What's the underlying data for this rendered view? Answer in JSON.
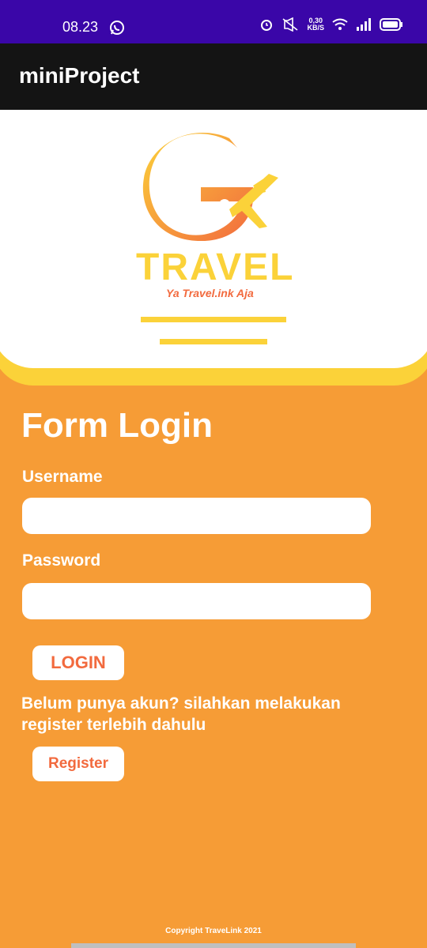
{
  "status_bar": {
    "time": "08.23",
    "net_speed_value": "0,30",
    "net_speed_unit": "KB/S",
    "icons": [
      "whatsapp-icon",
      "alarm-icon",
      "mute-icon",
      "wifi-icon",
      "signal-icon",
      "battery-icon"
    ]
  },
  "app_bar": {
    "title": "miniProject"
  },
  "brand": {
    "name": "TRAVEL",
    "tagline": "Ya Travel.ink Aja",
    "colors": {
      "yellow": "#FBD239",
      "orange": "#F26A3E"
    }
  },
  "form": {
    "title": "Form Login",
    "username_label": "Username",
    "username_value": "",
    "password_label": "Password",
    "password_value": "",
    "login_button": "LOGIN",
    "register_hint": "Belum punya akun? silahkan melakukan register terlebih dahulu",
    "register_button": "Register"
  },
  "footer": {
    "copyright": "Copyright TraveLink 2021"
  },
  "colors": {
    "background": "#F69C36",
    "status_bar": "#3A06A8",
    "app_bar": "#141414"
  }
}
